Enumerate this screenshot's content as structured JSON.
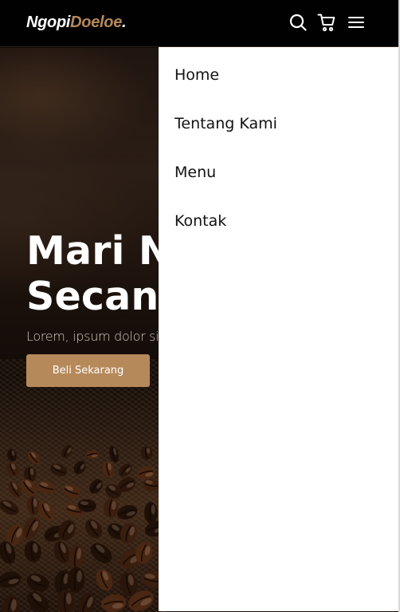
{
  "navbar": {
    "logo_primary": "Ngopi",
    "logo_accent": "Doeloe",
    "logo_dot": ".",
    "icons": [
      "search-icon",
      "cart-icon",
      "hamburger-menu-icon"
    ]
  },
  "hero": {
    "title_line1": "Mari N",
    "title_line2": "Secang",
    "subtitle": "Lorem, ipsum dolor sit",
    "cta_label": "Beli Sekarang"
  },
  "menu": {
    "items": [
      {
        "label": "Home"
      },
      {
        "label": "Tentang Kami"
      },
      {
        "label": "Menu"
      },
      {
        "label": "Kontak"
      }
    ]
  },
  "colors": {
    "accent": "#b6895b",
    "navbar_bg": "#010101",
    "menu_bg": "#ffffff",
    "text_light": "#ffffff",
    "text_dark": "#111111"
  }
}
